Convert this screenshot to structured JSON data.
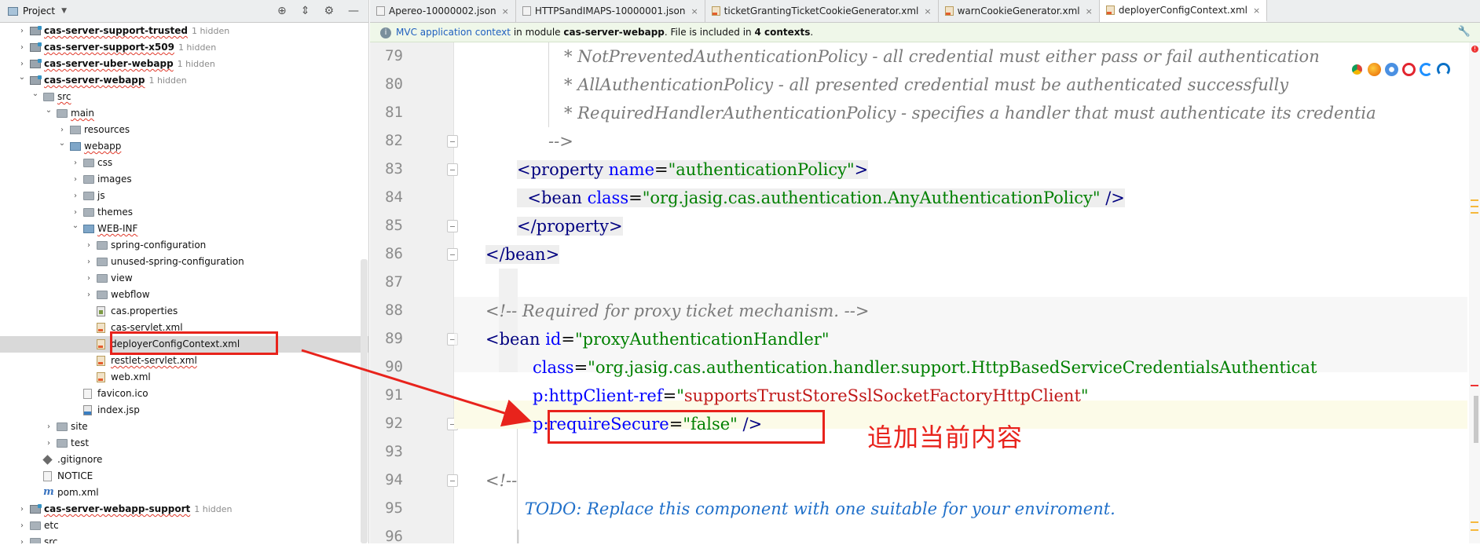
{
  "project_panel": {
    "title": "Project",
    "tree": [
      {
        "label": "cas-server-support-trusted",
        "hint": "1 hidden",
        "bold": true,
        "squiggle": true,
        "depth": 0,
        "state": "collapsed",
        "icon": "module-icon"
      },
      {
        "label": "cas-server-support-x509",
        "hint": "1 hidden",
        "bold": true,
        "squiggle": true,
        "depth": 0,
        "state": "collapsed",
        "icon": "module-icon"
      },
      {
        "label": "cas-server-uber-webapp",
        "hint": "1 hidden",
        "bold": true,
        "squiggle": true,
        "depth": 0,
        "state": "collapsed",
        "icon": "module-icon"
      },
      {
        "label": "cas-server-webapp",
        "hint": "1 hidden",
        "bold": true,
        "squiggle": true,
        "depth": 0,
        "state": "expanded",
        "icon": "module-icon"
      },
      {
        "label": "src",
        "depth": 1,
        "state": "expanded",
        "icon": "folder-icon",
        "squiggle": true
      },
      {
        "label": "main",
        "depth": 2,
        "state": "expanded",
        "icon": "folder-icon",
        "squiggle": true
      },
      {
        "label": "resources",
        "depth": 3,
        "state": "collapsed",
        "icon": "resources-folder-icon"
      },
      {
        "label": "webapp",
        "depth": 3,
        "state": "expanded",
        "icon": "web-folder-icon",
        "squiggle": true
      },
      {
        "label": "css",
        "depth": 4,
        "state": "collapsed",
        "icon": "folder-icon"
      },
      {
        "label": "images",
        "depth": 4,
        "state": "collapsed",
        "icon": "folder-icon"
      },
      {
        "label": "js",
        "depth": 4,
        "state": "collapsed",
        "icon": "folder-icon"
      },
      {
        "label": "themes",
        "depth": 4,
        "state": "collapsed",
        "icon": "folder-icon"
      },
      {
        "label": "WEB-INF",
        "depth": 4,
        "state": "expanded",
        "icon": "web-folder-icon",
        "squiggle": true
      },
      {
        "label": "spring-configuration",
        "depth": 5,
        "state": "collapsed",
        "icon": "folder-icon"
      },
      {
        "label": "unused-spring-configuration",
        "depth": 5,
        "state": "collapsed",
        "icon": "folder-icon"
      },
      {
        "label": "view",
        "depth": 5,
        "state": "collapsed",
        "icon": "folder-icon"
      },
      {
        "label": "webflow",
        "depth": 5,
        "state": "collapsed",
        "icon": "folder-icon"
      },
      {
        "label": "cas.properties",
        "depth": 5,
        "state": "leaf",
        "icon": "properties-file-icon"
      },
      {
        "label": "cas-servlet.xml",
        "depth": 5,
        "state": "leaf",
        "icon": "xml-file-icon"
      },
      {
        "label": "deployerConfigContext.xml",
        "depth": 5,
        "state": "leaf",
        "icon": "xml-file-icon",
        "selected": true
      },
      {
        "label": "restlet-servlet.xml",
        "depth": 5,
        "state": "leaf",
        "icon": "xml-file-icon",
        "squiggle": true
      },
      {
        "label": "web.xml",
        "depth": 5,
        "state": "leaf",
        "icon": "xml-file-icon"
      },
      {
        "label": "favicon.ico",
        "depth": 4,
        "state": "leaf",
        "icon": "image-file-icon"
      },
      {
        "label": "index.jsp",
        "depth": 4,
        "state": "leaf",
        "icon": "jsp-file-icon"
      },
      {
        "label": "site",
        "depth": 2,
        "state": "collapsed",
        "icon": "folder-icon"
      },
      {
        "label": "test",
        "depth": 2,
        "state": "collapsed",
        "icon": "folder-icon"
      },
      {
        "label": ".gitignore",
        "depth": 1,
        "state": "leaf",
        "icon": "git-file-icon"
      },
      {
        "label": "NOTICE",
        "depth": 1,
        "state": "leaf",
        "icon": "text-file-icon"
      },
      {
        "label": "pom.xml",
        "depth": 1,
        "state": "leaf",
        "icon": "maven-file-icon"
      },
      {
        "label": "cas-server-webapp-support",
        "hint": "1 hidden",
        "bold": true,
        "squiggle": true,
        "depth": 0,
        "state": "collapsed",
        "icon": "module-icon"
      },
      {
        "label": "etc",
        "depth": 0,
        "state": "collapsed",
        "icon": "folder-icon"
      },
      {
        "label": "src",
        "depth": 0,
        "state": "collapsed",
        "icon": "folder-icon"
      }
    ]
  },
  "tabs": [
    {
      "label": "Apereo-10000002.json",
      "active": false,
      "icon": "json-file-icon"
    },
    {
      "label": "HTTPSandIMAPS-10000001.json",
      "active": false,
      "icon": "json-file-icon"
    },
    {
      "label": "ticketGrantingTicketCookieGenerator.xml",
      "active": false,
      "icon": "xml-file-icon"
    },
    {
      "label": "warnCookieGenerator.xml",
      "active": false,
      "icon": "xml-file-icon"
    },
    {
      "label": "deployerConfigContext.xml",
      "active": true,
      "icon": "xml-file-icon"
    }
  ],
  "banner": {
    "link": "MVC application context",
    "in_module": "in module",
    "module": "cas-server-webapp",
    "file_included": ". File is included in",
    "contexts": "4 contexts",
    "end": "."
  },
  "code_lines": [
    {
      "n": "79",
      "fold": false
    },
    {
      "n": "80",
      "fold": false
    },
    {
      "n": "81",
      "fold": false
    },
    {
      "n": "82",
      "fold": true
    },
    {
      "n": "83",
      "fold": true
    },
    {
      "n": "84",
      "fold": false
    },
    {
      "n": "85",
      "fold": true
    },
    {
      "n": "86",
      "fold": true
    },
    {
      "n": "87",
      "fold": false
    },
    {
      "n": "88",
      "fold": false
    },
    {
      "n": "89",
      "fold": true
    },
    {
      "n": "90",
      "fold": false
    },
    {
      "n": "91",
      "fold": false
    },
    {
      "n": "92",
      "fold": true
    },
    {
      "n": "93",
      "fold": false
    },
    {
      "n": "94",
      "fold": true
    },
    {
      "n": "95",
      "fold": false
    },
    {
      "n": "96",
      "fold": false
    }
  ],
  "code": {
    "l79": "* NotPreventedAuthenticationPolicy - all credential must either pass or fail authentication",
    "l80": "* AllAuthenticationPolicy - all presented credential must be authenticated successfully",
    "l81": "* RequiredHandlerAuthenticationPolicy - specifies a handler that must authenticate its credentia",
    "l82": "-->",
    "l83_tag": "<property",
    "l83_attr": "name",
    "l83_eq": "=",
    "l83_val": "\"authenticationPolicy\"",
    "l83_close": ">",
    "l84_tag": "<bean",
    "l84_attr": "class",
    "l84_eq": "=",
    "l84_val": "\"org.jasig.cas.authentication.AnyAuthenticationPolicy\"",
    "l84_close": " />",
    "l85": "</property>",
    "l86": "</bean>",
    "l88": "<!-- Required for proxy ticket mechanism. -->",
    "l89_tag": "<bean",
    "l89_attr": "id",
    "l89_eq": "=",
    "l89_val": "\"proxyAuthenticationHandler\"",
    "l90_attr": "class",
    "l90_eq": "=",
    "l90_val": "\"org.jasig.cas.authentication.handler.support.HttpBasedServiceCredentialsAuthenticat",
    "l91_attr": "p:httpClient-ref",
    "l91_eq": "=",
    "l91_q1": "\"",
    "l91_val": "supportsTrustStoreSslSocketFactoryHttpClient",
    "l91_q2": "\"",
    "l92_attr": "p:requireSecure",
    "l92_eq": "=",
    "l92_val": "\"false\"",
    "l92_close": " />",
    "l94": "<!--",
    "l95_todo": "TODO: Replace this component with one suitable for your enviroment.",
    "l96": "|"
  },
  "annotation": "追加当前内容",
  "colors": {
    "annotation_red": "#e8231c",
    "tag": "#000080",
    "attr": "#0000ff",
    "value": "#008000",
    "comment": "#7a7a7a"
  }
}
